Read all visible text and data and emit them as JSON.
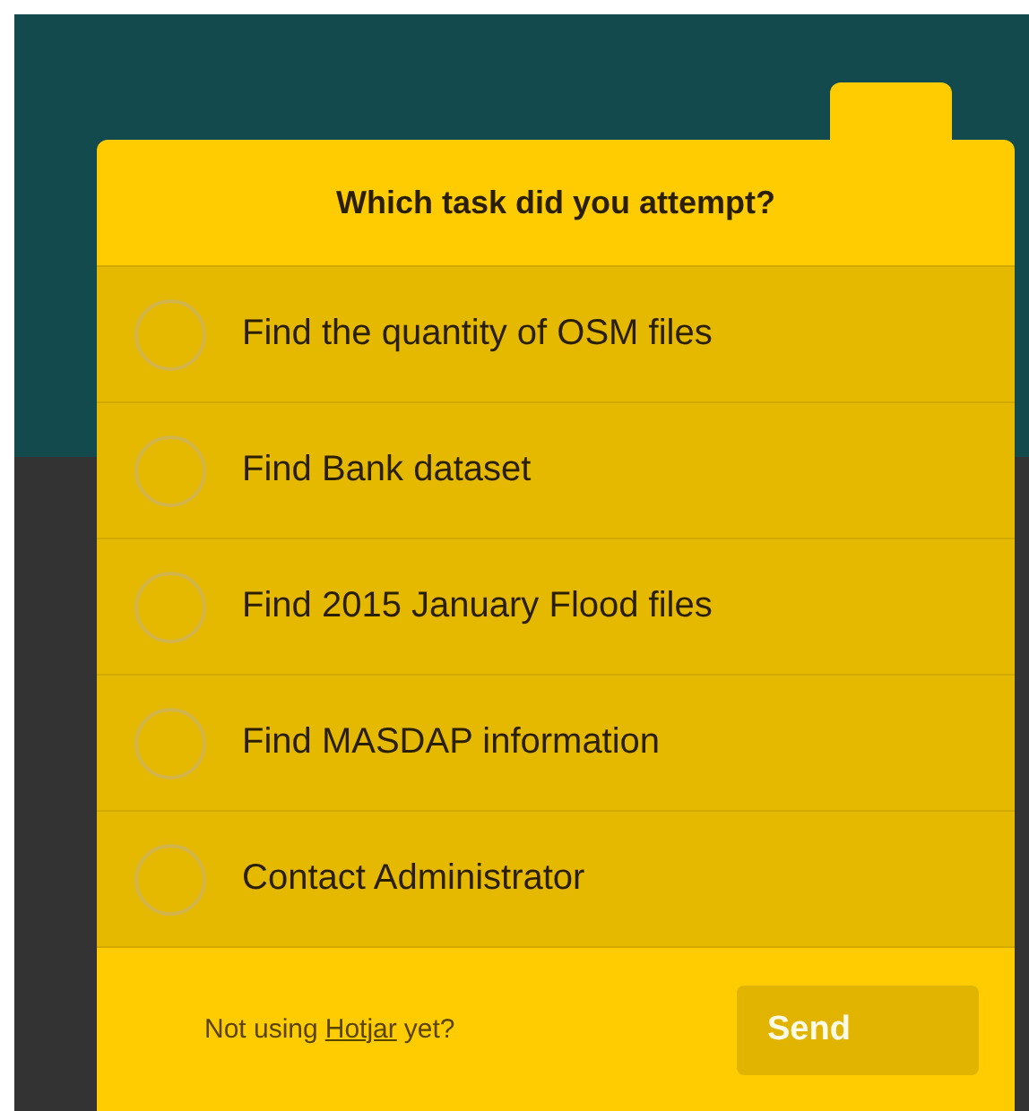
{
  "poll": {
    "question": "Which task did you attempt?",
    "options": [
      {
        "label": "Find the quantity of OSM files",
        "selected": false
      },
      {
        "label": "Find Bank dataset",
        "selected": false
      },
      {
        "label": "Find 2015 January Flood files",
        "selected": false
      },
      {
        "label": "Find MASDAP information",
        "selected": false
      },
      {
        "label": "Contact Administrator",
        "selected": false
      }
    ],
    "footer": {
      "text_before": "Not using",
      "link": "Hotjar",
      "text_after": "yet?"
    },
    "send_button": {
      "label": "Send",
      "disabled": true
    }
  }
}
